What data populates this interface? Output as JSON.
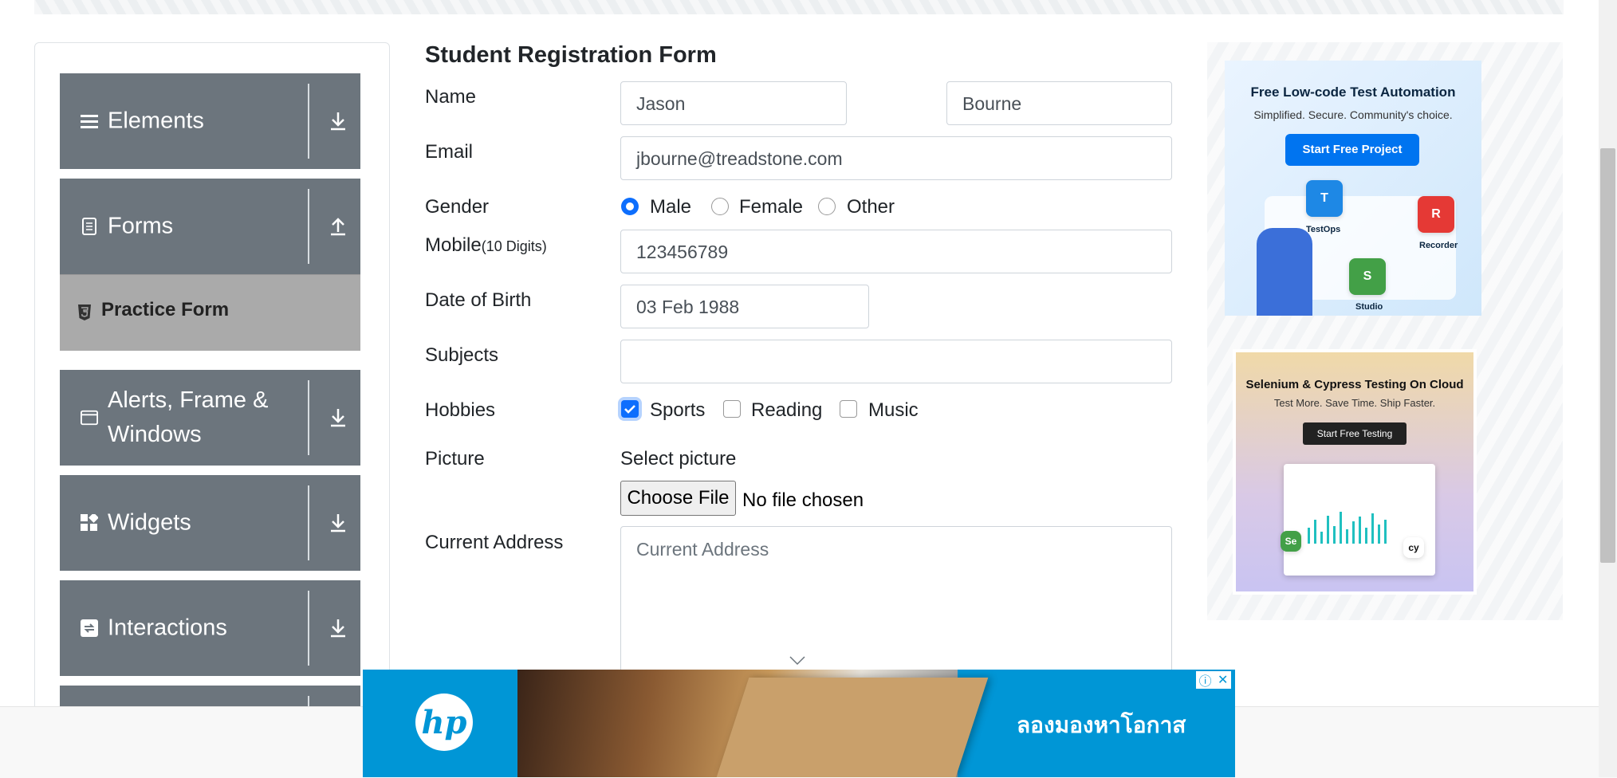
{
  "sidebar": {
    "groups": [
      {
        "label": "Elements",
        "icon": "hamburger-icon",
        "arrow": "download-icon"
      },
      {
        "label": "Forms",
        "icon": "document-icon",
        "arrow": "upload-icon"
      },
      {
        "label": "Alerts, Frame & Windows",
        "icon": "window-icon",
        "arrow": "download-icon"
      },
      {
        "label": "Widgets",
        "icon": "widgets-icon",
        "arrow": "download-icon"
      },
      {
        "label": "Interactions",
        "icon": "interactions-icon",
        "arrow": "download-icon"
      }
    ],
    "active_item": "Practice Form"
  },
  "form": {
    "title": "Student Registration Form",
    "name_label": "Name",
    "first_name": "Jason",
    "last_name": "Bourne",
    "email_label": "Email",
    "email": "jbourne@treadstone.com",
    "gender_label": "Gender",
    "gender_options": [
      "Male",
      "Female",
      "Other"
    ],
    "gender_selected": "Male",
    "mobile_label": "Mobile",
    "mobile_hint": "(10 Digits)",
    "mobile": "123456789",
    "dob_label": "Date of Birth",
    "dob": "03 Feb 1988",
    "subjects_label": "Subjects",
    "subjects": "",
    "hobbies_label": "Hobbies",
    "hobbies": [
      "Sports",
      "Reading",
      "Music"
    ],
    "hobbies_checked": [
      "Sports"
    ],
    "picture_label": "Picture",
    "select_picture": "Select picture",
    "choose_file": "Choose File",
    "no_file": "No file chosen",
    "address_label": "Current Address",
    "address_placeholder": "Current Address"
  },
  "ads": {
    "ad1": {
      "title": "Free Low-code Test Automation",
      "subtitle": "Simplified. Secure. Community's choice.",
      "button": "Start Free Project",
      "tiles": [
        "TestOps",
        "Recorder",
        "Studio"
      ]
    },
    "ad2": {
      "title": "Selenium & Cypress Testing On Cloud",
      "subtitle": "Test More. Save Time. Ship Faster.",
      "button": "Start Free Testing"
    },
    "bottom": {
      "brand": "hp",
      "text": "ลองมองหาโอกาส"
    }
  },
  "colors": {
    "sidebar_group": "#6c757d",
    "submenu_active": "#aaaaaa",
    "accent": "#0d6efd",
    "hp_blue": "#0096d6"
  }
}
